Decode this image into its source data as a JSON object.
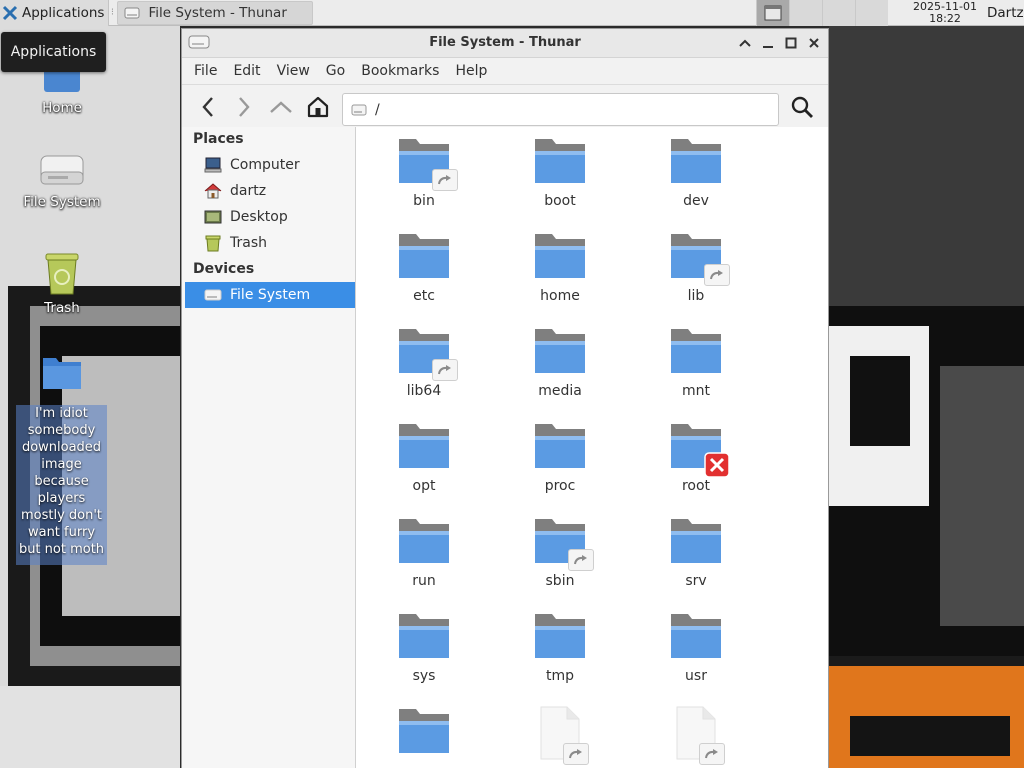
{
  "panel": {
    "apps_label": "Applications",
    "separator": "⁝",
    "task_label": "File System - Thunar",
    "clock_date": "2025-11-01",
    "clock_time": "18:22",
    "user": "Dartz"
  },
  "tooltip": "Applications",
  "desktop": {
    "icons": [
      {
        "label": "Home"
      },
      {
        "label": "File System"
      },
      {
        "label": "Trash"
      }
    ],
    "note_lines": [
      "I'm idiot",
      "somebody",
      "downloaded",
      "image",
      "because",
      "players",
      "mostly don't",
      "want furry",
      "but not moth"
    ]
  },
  "window": {
    "title": "File System - Thunar",
    "menu": [
      "File",
      "Edit",
      "View",
      "Go",
      "Bookmarks",
      "Help"
    ],
    "location_path": "/"
  },
  "sidebar": {
    "places_heading": "Places",
    "places": [
      {
        "label": "Computer",
        "icon": "computer-icon"
      },
      {
        "label": "dartz",
        "icon": "home-icon"
      },
      {
        "label": "Desktop",
        "icon": "desktop-icon"
      },
      {
        "label": "Trash",
        "icon": "trash-icon"
      }
    ],
    "devices_heading": "Devices",
    "devices": [
      {
        "label": "File System",
        "icon": "drive-icon",
        "selected": true
      }
    ]
  },
  "files": [
    {
      "name": "bin",
      "link": true
    },
    {
      "name": "boot"
    },
    {
      "name": "dev"
    },
    {
      "name": "etc"
    },
    {
      "name": "home"
    },
    {
      "name": "lib",
      "link": true
    },
    {
      "name": "lib64",
      "link": true
    },
    {
      "name": "media"
    },
    {
      "name": "mnt"
    },
    {
      "name": "opt"
    },
    {
      "name": "proc"
    },
    {
      "name": "root",
      "locked": true
    },
    {
      "name": "run"
    },
    {
      "name": "sbin",
      "link": true
    },
    {
      "name": "srv"
    },
    {
      "name": "sys"
    },
    {
      "name": "tmp"
    },
    {
      "name": "usr"
    },
    {
      "name": "",
      "kind": "folder"
    },
    {
      "name": "",
      "kind": "file",
      "link": true
    },
    {
      "name": "",
      "kind": "file",
      "link": true
    }
  ]
}
